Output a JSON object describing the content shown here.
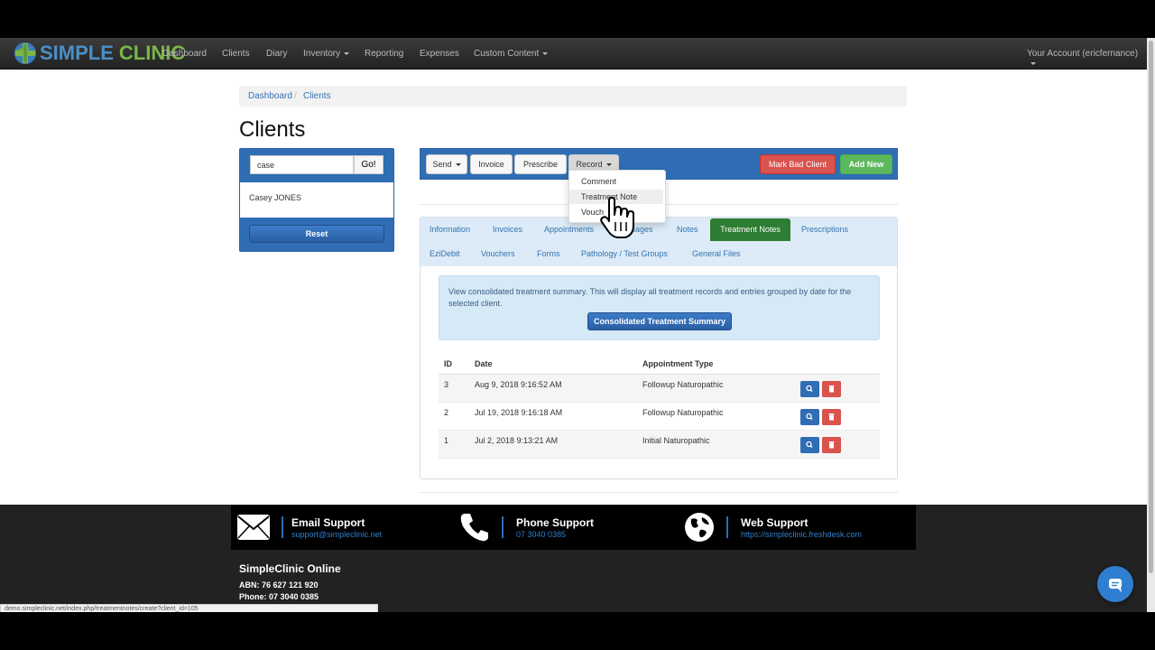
{
  "brand": {
    "word1": "SIMPLE",
    "word2": "CLINIC"
  },
  "nav": {
    "items": [
      "Dashboard",
      "Clients",
      "Diary",
      "Inventory",
      "Reporting",
      "Expenses",
      "Custom Content"
    ],
    "account": "Your Account (ericfernance)"
  },
  "breadcrumb": {
    "items": [
      "Dashboard",
      "Clients"
    ],
    "sep": "/"
  },
  "page_title": "Clients",
  "search": {
    "value": "case",
    "go": "Go!",
    "result": "Casey JONES",
    "reset": "Reset"
  },
  "toolbar": {
    "send": "Send",
    "invoice": "Invoice",
    "prescribe": "Prescribe",
    "record": "Record",
    "mark_bad": "Mark Bad Client",
    "add_new": "Add New"
  },
  "record_menu": {
    "items": [
      "Comment",
      "Treatment Note",
      "Vouch"
    ]
  },
  "tabs": {
    "row1": [
      "Information",
      "Invoices",
      "Appointments",
      "ssages",
      "Notes",
      "Treatment Notes",
      "Prescriptions"
    ],
    "row2": [
      "EziDebit",
      "Vouchers",
      "Forms",
      "Pathology / Test Groups",
      "General Files"
    ]
  },
  "summary": {
    "text": "View consolidated treatment summary. This will display all treatment records and entries grouped by date for the selected client.",
    "button": "Consolidated Treatment Summary"
  },
  "records": {
    "headers": [
      "ID",
      "Date",
      "Appointment Type"
    ],
    "rows": [
      {
        "id": "3",
        "date": "Aug 9, 2018 9:16:52 AM",
        "type": "Followup Naturopathic"
      },
      {
        "id": "2",
        "date": "Jul 19, 2018 9:16:18 AM",
        "type": "Followup Naturopathic"
      },
      {
        "id": "1",
        "date": "Jul 2, 2018 9:13:21 AM",
        "type": "Initial Naturopathic"
      }
    ]
  },
  "support": {
    "email": {
      "title": "Email Support",
      "link": "support@simpleclinic.net"
    },
    "phone": {
      "title": "Phone Support",
      "link": "07 3040 0385"
    },
    "web": {
      "title": "Web Support",
      "link": "https://simpleclinic.freshdesk.com"
    }
  },
  "footer": {
    "title": "SimpleClinic Online",
    "abn": "ABN: 76 627 121 920",
    "phone": "Phone: 07 3040 0385"
  },
  "status_url": "demo.simpleclinic.net/index.php/treatmentnotes/create?client_id=105",
  "colors": {
    "primary": "#2f6db4",
    "success": "#5cb85c",
    "danger": "#d9534f",
    "active_tab": "#2d7d32",
    "navbar": "#2b2b2b"
  }
}
